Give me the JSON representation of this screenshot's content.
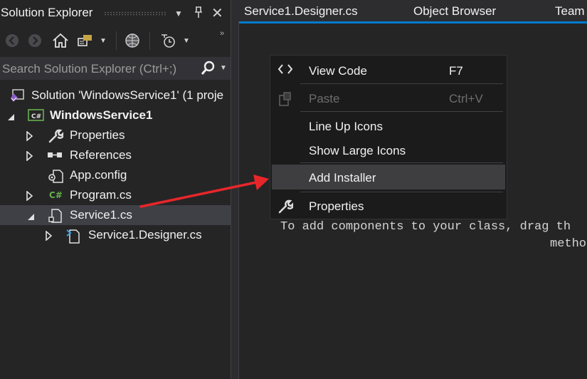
{
  "solution_explorer": {
    "title": "Solution Explorer",
    "search_placeholder": "Search Solution Explorer (Ctrl+;)",
    "tree": [
      {
        "label": "Solution 'WindowsService1' (1 proje",
        "icon": "solution-icon"
      },
      {
        "label": "WindowsService1",
        "icon": "csharp-project-icon"
      },
      {
        "label": "Properties",
        "icon": "wrench-icon"
      },
      {
        "label": "References",
        "icon": "references-icon"
      },
      {
        "label": "App.config",
        "icon": "config-icon"
      },
      {
        "label": "Program.cs",
        "icon": "csharp-file-icon"
      },
      {
        "label": "Service1.cs",
        "icon": "service-file-icon"
      },
      {
        "label": "Service1.Designer.cs",
        "icon": "designer-file-icon"
      }
    ]
  },
  "editor": {
    "tabs": [
      "Service1.Designer.cs",
      "Object Browser",
      "Team"
    ],
    "hint_line1": "To add components to your class, drag th",
    "hint_line2": "metho"
  },
  "context_menu": {
    "items": [
      {
        "label": "View Code",
        "shortcut": "F7",
        "icon": "code-brackets-icon",
        "enabled": true
      },
      {
        "label": "Paste",
        "shortcut": "Ctrl+V",
        "icon": "paste-icon",
        "enabled": false
      },
      {
        "label": "Line Up Icons",
        "shortcut": "",
        "icon": "",
        "enabled": true
      },
      {
        "label": "Show Large Icons",
        "shortcut": "",
        "icon": "",
        "enabled": true
      },
      {
        "label": "Add Installer",
        "shortcut": "",
        "icon": "",
        "enabled": true,
        "highlighted": true
      },
      {
        "label": "Properties",
        "shortcut": "",
        "icon": "wrench-icon",
        "enabled": true
      }
    ]
  },
  "colors": {
    "accent": "#007acc",
    "annotation_arrow": "#e8262a",
    "selection": "#3f3f46"
  }
}
